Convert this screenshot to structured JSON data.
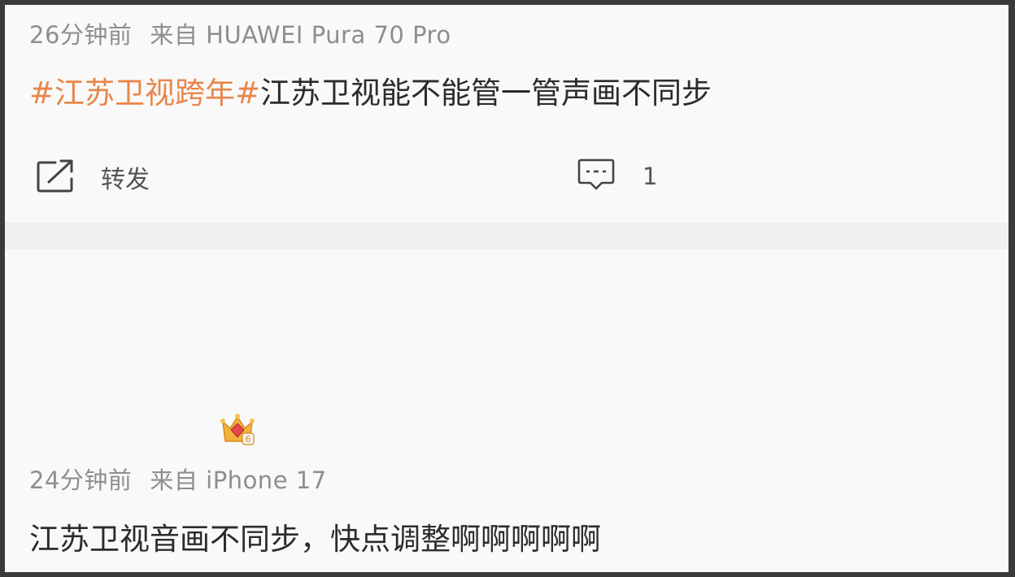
{
  "post1": {
    "time": "26分钟前",
    "source_prefix": "来自",
    "device": "HUAWEI Pura 70 Pro",
    "hashtag": "#江苏卫视跨年#",
    "text": "江苏卫视能不能管一管声画不同步",
    "share_label": "转发",
    "comment_count": "1"
  },
  "post2": {
    "time": "24分钟前",
    "source_prefix": "来自",
    "device": "iPhone 17",
    "text": "江苏卫视音画不同步，快点调整啊啊啊啊啊",
    "badge_level": "6"
  },
  "icons": {
    "share": "share-icon",
    "comment": "comment-icon",
    "crown": "crown-badge-icon"
  },
  "colors": {
    "hashtag": "#e8864a",
    "meta": "#8e8e8e",
    "text": "#2c2c2c",
    "background": "#f9f9f9",
    "divider": "#f0f0f0"
  }
}
